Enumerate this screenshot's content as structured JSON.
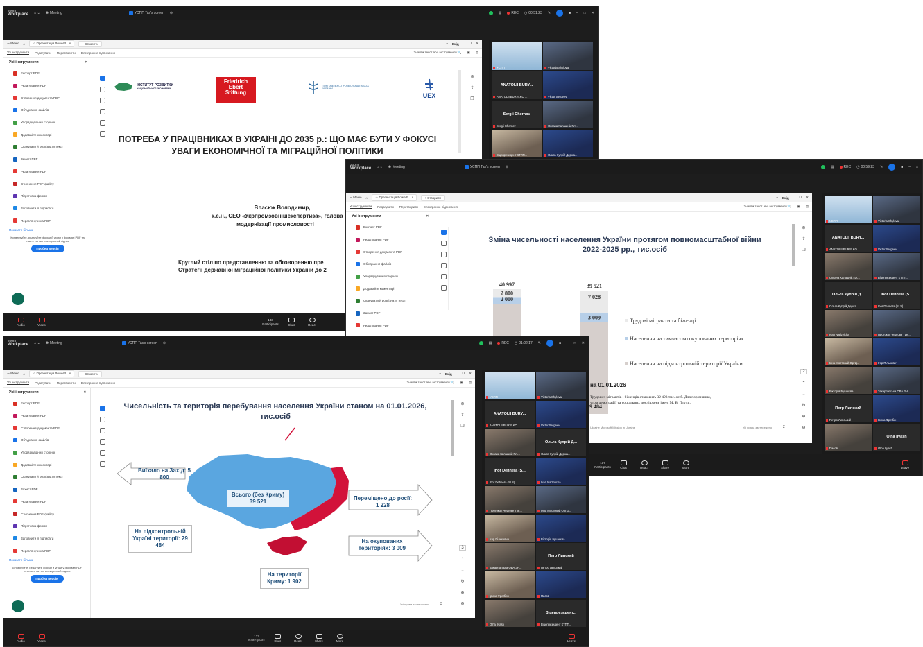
{
  "zoom": {
    "brand_top": "zoom",
    "brand": "Workplace",
    "meeting_label": "Meeting",
    "screen_label": "УСПП Tas's screen",
    "rec_label": "REC",
    "timer1": "00:51:23",
    "timer2": "00:59:23",
    "timer3": "01:02:17",
    "participants_count": "133",
    "participants_count_mid": "137",
    "bottom": {
      "audio": "Audio",
      "video": "Video",
      "participants": "Participants",
      "chat": "Chat",
      "react": "React",
      "share": "Share",
      "more": "More",
      "leave": "Leave"
    }
  },
  "browser": {
    "menu": "Меню",
    "tab_title": "Презентація PowerP...",
    "new_tab": "Створити",
    "signin": "Вхід",
    "menubar": [
      "Усі інструменти",
      "Редагувати",
      "Перетворити",
      "Електронне підписання"
    ],
    "search_placeholder": "Знайти текст або інструменти"
  },
  "tools_panel": {
    "title": "Усі інструменти",
    "close": "×",
    "items": [
      "Експорт PDF",
      "Редагування PDF",
      "Створення документа PDF",
      "Об'єднання файлів",
      "Упорядкування сторінок",
      "Додавайте коментарі",
      "Сканувати й розпізнати текст",
      "Захист PDF",
      "Редагування PDF",
      "Стиснення PDF-файлу",
      "Підготовка форми",
      "Заповнити й підписати",
      "Переглянути на PDF"
    ],
    "icon_colors": [
      "#d93025",
      "#c2185b",
      "#e53935",
      "#1a73e8",
      "#43a047",
      "#f9a825",
      "#2e7d32",
      "#1565c0",
      "#e53935",
      "#c62828",
      "#5e35b1",
      "#1e88e5",
      "#e53935"
    ],
    "show_more": "Показати більше",
    "promo": "Конвертуйте, редагуйте форми й угоди у форматі PDF та ставте на них електронний підпис",
    "try_button": "Пробна версія"
  },
  "slide1": {
    "logo_ire": "ІНСТИТУТ РОЗВИТКУ",
    "logo_ire_sub": "НАЦІОНАЛЬНОЇ ЕКОНОМІКИ",
    "logo_fes": "Friedrich Ebert Stiftung",
    "logo_uspp": "ТОРГОВЕЛЬНО-ПРОМИСЛОВА ПАЛАТА УКРАЇНИ",
    "logo_uex": "UEX",
    "title": "ПОТРЕБА У ПРАЦІВНИКАХ В УКРАЇНІ ДО 2035 р.: ЩО МАЄ БУТИ У ФОКУСІ УВАГИ ЕКОНОМІЧНОЇ ТА МІГРАЦІЙНОЇ ПОЛІТИКИ",
    "author": "Власюк Володимир,",
    "author_role": "к.е.н., CEO «Укрпромзовнішекспертиза», голова комітету ТПП",
    "author_role2": "модернізації промисловості",
    "event": "Круглий стіл по представленню та обговоренню пре",
    "event2": "Стратегії державної міграційної політики України до 2"
  },
  "slide2": {
    "title": "Зміна чисельності населення України протягом повномаcштабної війни 2022-2025 рр., тис.осіб",
    "date_caption": "на 01.01.2026",
    "note": "Трудових мігрантів і біженців становить 32 493 тис. осіб. Для порівняння,",
    "note2": "утом демографії та соціальних досліджень імені М. В. Птухи.",
    "footer_left": "Ukraine Microsoft Mission in Ukraine",
    "footer_right": "Усі права застережено",
    "page": "2"
  },
  "slide3": {
    "title": "Чисельність та територія перебування населення України станом на 01.01.2026, тис.осіб",
    "total": "Всього (без Криму)",
    "total_value": "39 521",
    "west": "Виїхало на Захід: 5 800",
    "russia": "Переміщено до росії: 1 228",
    "controlled": "На підконтрольній Україні території: 29 484",
    "occupied": "На окупованих територіях: 3 009",
    "crimea": "На території Криму: 1 902",
    "footer": "Усі права застережено",
    "page": "3"
  },
  "chart_data": {
    "type": "bar",
    "title": "Зміна чисельності населення України протягом повномаcштабної війни 2022-2025 рр., тис.осіб",
    "categories": [
      "",
      ""
    ],
    "totals": [
      40997,
      39521
    ],
    "series": [
      {
        "name": "Населення на підконтрольній території України",
        "values": [
          36198,
          29484
        ]
      },
      {
        "name": "Населення на тимчасово окупованих територіях",
        "values": [
          2000,
          3009
        ]
      },
      {
        "name": "Трудові мігранти та біженці",
        "values": [
          2800,
          7028
        ]
      }
    ],
    "legend": "right",
    "colors": [
      "#d6cfcc",
      "#b7cfe8",
      "#eaeaea"
    ]
  },
  "gallery": {
    "win1": [
      {
        "name": "УСПП",
        "kind": "share",
        "big": ""
      },
      {
        "name": "Victoria Shylova",
        "kind": "photo",
        "big": ""
      },
      {
        "name": "ANATOLII BURYLKO ...",
        "kind": "dark",
        "big": "ANATOLII BURY..."
      },
      {
        "name": "Victor Sergeev",
        "kind": "photo",
        "big": ""
      },
      {
        "name": "Sergii Chernov",
        "kind": "dark",
        "big": "Sergii Chernov"
      },
      {
        "name": "Оксана Калашнік ПА...",
        "kind": "photo",
        "big": ""
      },
      {
        "name": "Віцепрезидент КТПП...",
        "kind": "photo",
        "big": ""
      },
      {
        "name": "Ольга Купрій Держа...",
        "kind": "photo",
        "big": ""
      }
    ],
    "win2": [
      {
        "name": "УСПП",
        "kind": "share",
        "big": ""
      },
      {
        "name": "Victoria Shylova",
        "kind": "photo",
        "big": ""
      },
      {
        "name": "ANATOLII BURYLKO ...",
        "kind": "dark",
        "big": "ANATOLII BURY..."
      },
      {
        "name": "Victor Sergeev",
        "kind": "photo",
        "big": ""
      },
      {
        "name": "Оксана Калашнік ПА...",
        "kind": "photo",
        "big": ""
      },
      {
        "name": "Віцепрезидент КТПП...",
        "kind": "photo",
        "big": ""
      },
      {
        "name": "Ольга Купрій Держа...",
        "kind": "dark",
        "big": "Ольга Купрій Д..."
      },
      {
        "name": "Ihor Dehnera (SLS)",
        "kind": "dark",
        "big": "Ihor Dehnera (S..."
      },
      {
        "name": "Ivan Nadzvicha",
        "kind": "photo",
        "big": ""
      },
      {
        "name": "Протокол Чергове Тре...",
        "kind": "photo",
        "big": ""
      },
      {
        "name": "Iнна Мостовий ОргЦ...",
        "kind": "photo",
        "big": ""
      },
      {
        "name": "Ігор Пількевич",
        "kind": "photo",
        "big": ""
      },
      {
        "name": "Вікторія Бушнієва",
        "kind": "photo",
        "big": ""
      },
      {
        "name": "Закарпатська ОВА ЗН...",
        "kind": "photo",
        "big": ""
      },
      {
        "name": "Петро Липський",
        "kind": "dark",
        "big": "Петр Липский"
      },
      {
        "name": "Iрина Фреїбен",
        "kind": "photo",
        "big": ""
      },
      {
        "name": "Пасов",
        "kind": "photo",
        "big": ""
      },
      {
        "name": "Olha Ilyash",
        "kind": "dark",
        "big": "Olha Ilyash"
      }
    ],
    "win3": [
      {
        "name": "УСПП",
        "kind": "share",
        "big": ""
      },
      {
        "name": "Victoria Shylova",
        "kind": "photo",
        "big": ""
      },
      {
        "name": "ANATOLII BURYLKO ...",
        "kind": "dark",
        "big": "ANATOLII BURY..."
      },
      {
        "name": "Victor Sergeev",
        "kind": "photo",
        "big": ""
      },
      {
        "name": "Оксана Калашнік ПА...",
        "kind": "photo",
        "big": ""
      },
      {
        "name": "Ольга Купрій Держа...",
        "kind": "dark",
        "big": "Ольга Купрій Д..."
      },
      {
        "name": "Ihor Dehnera (SLS)",
        "kind": "dark",
        "big": "Ihor Dehnera (S..."
      },
      {
        "name": "Ivan Nadzvicha",
        "kind": "photo",
        "big": ""
      },
      {
        "name": "Протокол Чергове Тре...",
        "kind": "photo",
        "big": ""
      },
      {
        "name": "Iнна Мостовий ОргЦ...",
        "kind": "photo",
        "big": ""
      },
      {
        "name": "Ігор Пількевич",
        "kind": "photo",
        "big": ""
      },
      {
        "name": "Вікторія Бушнієва",
        "kind": "photo",
        "big": ""
      },
      {
        "name": "Закарпатська ОВА ЗН...",
        "kind": "photo",
        "big": ""
      },
      {
        "name": "Петро Липський",
        "kind": "dark",
        "big": "Петр Липский"
      },
      {
        "name": "Iрина Фреїбен",
        "kind": "photo",
        "big": ""
      },
      {
        "name": "Пасов",
        "kind": "photo",
        "big": ""
      },
      {
        "name": "Olha Ilyash",
        "kind": "photo",
        "big": ""
      },
      {
        "name": "Віцепрезидент КТПП...",
        "kind": "dark",
        "big": "Віцепрезидент..."
      }
    ]
  }
}
